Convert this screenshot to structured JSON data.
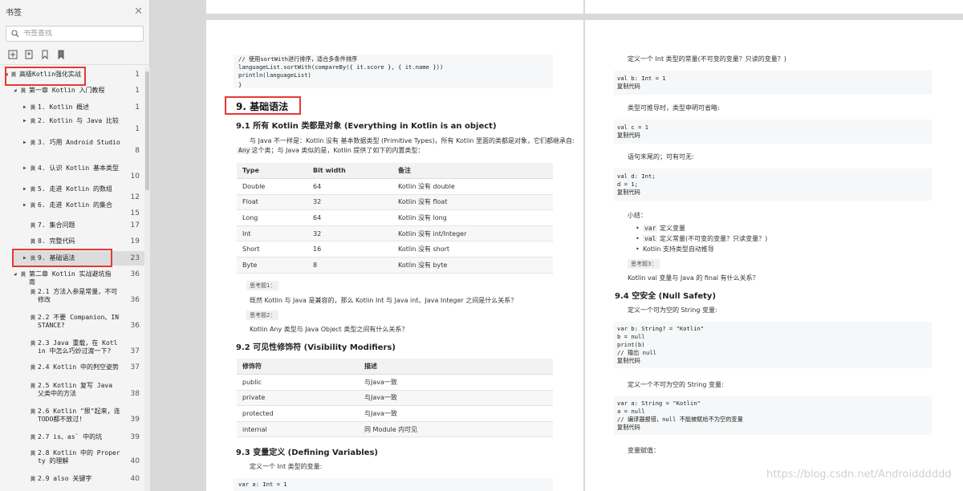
{
  "sidebar": {
    "title": "书签",
    "close_icon": "close-icon",
    "search_placeholder": "书签查找",
    "tools": [
      "expand-bookmark-icon",
      "add-bookmark-icon",
      "bookmark-icon",
      "bookmark-outline-icon"
    ],
    "items": [
      {
        "label": "高级Kotlin强化实战",
        "page": "1",
        "level": 0,
        "expanded": true
      },
      {
        "label": "第一章 Kotlin 入门教程",
        "page": "1",
        "level": 1,
        "expanded": true
      },
      {
        "label": "1. Kotlin 概述",
        "page": "1",
        "level": 2,
        "expanded": false
      },
      {
        "label": "2. Kotlin 与 Java 比较",
        "page": "1",
        "level": 2,
        "expanded": false
      },
      {
        "label": "3. 巧用 Android Studio",
        "page": "8",
        "level": 2,
        "expanded": false
      },
      {
        "label": "4. 认识 Kotlin 基本类型",
        "page": "10",
        "level": 2,
        "expanded": false
      },
      {
        "label": "5. 走进 Kotlin 的数组",
        "page": "12",
        "level": 2,
        "expanded": false
      },
      {
        "label": "6. 走进 Kotlin 的集合",
        "page": "15",
        "level": 2,
        "expanded": false
      },
      {
        "label": "7. 集合问题",
        "page": "17",
        "level": 2,
        "expanded": null
      },
      {
        "label": "8. 完整代码",
        "page": "19",
        "level": 2,
        "expanded": null
      },
      {
        "label": "9. 基础语法",
        "page": "23",
        "level": 2,
        "expanded": false,
        "selected": true
      },
      {
        "label": "第二章 Kotlin 实战避坑指南",
        "page": "36",
        "level": 1,
        "expanded": true
      },
      {
        "label": "2.1 方法入参是常量，不可修改",
        "page": "36",
        "level": 2,
        "expanded": null
      },
      {
        "label": "2.2 不要 Companion、INSTANCE?",
        "page": "36",
        "level": 2,
        "expanded": null
      },
      {
        "label": "2.3 Java 重载，在 Kotlin 中怎么巧妙过渡一下?",
        "page": "37",
        "level": 2,
        "expanded": null
      },
      {
        "label": "2.4 Kotlin 中的判空姿势",
        "page": "37",
        "level": 2,
        "expanded": null
      },
      {
        "label": "2.5 Kotlin 复写 Java 父类中的方法",
        "page": "38",
        "level": 2,
        "expanded": null
      },
      {
        "label": "2.6 Kotlin \"狠\"起来，连TODO都不放过!",
        "page": "39",
        "level": 2,
        "expanded": null
      },
      {
        "label": "2.7 is、as` 中的坑",
        "page": "39",
        "level": 2,
        "expanded": null
      },
      {
        "label": "2.8 Kotlin 中的 Property 的理解",
        "page": "40",
        "level": 2,
        "expanded": null
      },
      {
        "label": "2.9 also 关键字",
        "page": "40",
        "level": 2,
        "expanded": null
      }
    ]
  },
  "left_page": {
    "code_top": {
      "lines": [
        "    // 使用sortWith进行排序，适合多条件排序",
        "    languageList.sortWith(compareBy({ it.score }, { it.name }))",
        "    println(languageList)"
      ],
      "closing": "}"
    },
    "h1": "9. 基础语法",
    "h2_1": "9.1 所有 Kotlin 类都是对象 (Everything in Kotlin is an object)",
    "p1_line1": "与 Java 不一样是：Kotlin 没有 基本数据类型 (Primitive Types)，所有 Kotlin 里面的类都是对象，它们都继承自:",
    "p1_code": "Any",
    "p1_line2": "这个类；与 Java 类似的是，Kotlin 提供了如下的内置类型：",
    "table1": {
      "headers": [
        "Type",
        "Bit width",
        "备注"
      ],
      "rows": [
        [
          "Double",
          "64",
          "Kotlin 没有 double"
        ],
        [
          "Float",
          "32",
          "Kotlin 没有 float"
        ],
        [
          "Long",
          "64",
          "Kotlin 没有 long"
        ],
        [
          "Int",
          "32",
          "Kotlin 没有 int/Integer"
        ],
        [
          "Short",
          "16",
          "Kotlin 没有 short"
        ],
        [
          "Byte",
          "8",
          "Kotlin 没有 byte"
        ]
      ]
    },
    "think1_tag": "思考题1：",
    "think1_text": "既然 Kotlin 与 Java 是兼容的，那么 Kotlin Int 与 Java int、Java Integer 之间是什么关系？",
    "think2_tag": "思考题2：",
    "think2_text": "Kotlin Any 类型与 Java Object 类型之间有什么关系？",
    "h2_2": "9.2 可见性修饰符 (Visibility Modifiers)",
    "table2": {
      "headers": [
        "修饰符",
        "描述"
      ],
      "rows": [
        [
          "public",
          "与Java一致"
        ],
        [
          "private",
          "与Java一致"
        ],
        [
          "protected",
          "与Java一致"
        ],
        [
          "internal",
          "同 Module 内可见"
        ]
      ]
    },
    "h2_3": "9.3 变量定义 (Defining Variables)",
    "p3": "定义一个 Int 类型的变量:",
    "code_bottom": "var a: Int = 1"
  },
  "right_page": {
    "p_a": "定义一个 Int 类型的常量(不可变的变量？只读的变量？)",
    "code_a": [
      "val b: Int = 1",
      "复制代码"
    ],
    "p_b": "类型可推导时，类型申明可省略:",
    "code_b": [
      "val c = 1",
      "复制代码"
    ],
    "p_c": "语句末尾的；可有可无:",
    "code_c": [
      "val d: Int;",
      "d = 1;",
      "复制代码"
    ],
    "summary": "小结：",
    "bullets": [
      {
        "code": "var",
        "text": " 定义变量"
      },
      {
        "code": "val",
        "text": " 定义常量(不可变的变量？只读变量？)"
      },
      {
        "code": "",
        "text": "Kotlin 支持类型自动推导"
      }
    ],
    "think3_tag": "思考题3：",
    "think3_text": "Kotlin val 变量与 Java 的 final 有什么关系？",
    "h2_4": "9.4 空安全 (Null Safety)",
    "p_d": "定义一个可为空的 String 变量:",
    "code_d": [
      "var b: String? = \"Kotlin\"",
      "b = null",
      "print(b)",
      "// 输出 null",
      "复制代码"
    ],
    "p_e": "定义一个不可为空的 String 变量:",
    "code_e": [
      "var a: String = \"Kotlin\"",
      "a = null",
      "// 编译器报错，null 不能被赋给不为空的变量",
      "复制代码"
    ],
    "p_f": "变量赋值："
  },
  "watermark": "https://blog.csdn.net/Androidddddd"
}
